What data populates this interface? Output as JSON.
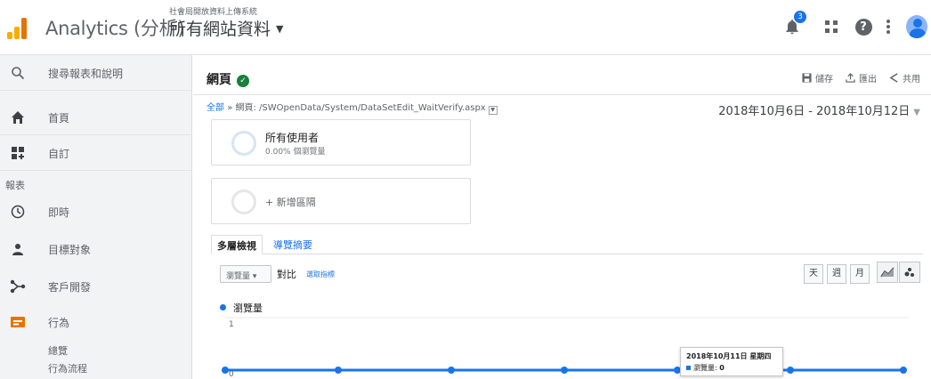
{
  "header": {
    "app_name": "Analytics (分析)",
    "account": "社會局開放資料上傳系統",
    "view": "所有網站資料",
    "notification_count": "3",
    "help_glyph": "?",
    "colors": {
      "logo_dark": "#e37400",
      "logo_light": "#f9ab00",
      "accent": "#1a73e8"
    }
  },
  "sidebar": {
    "search_label": "搜尋報表和說明",
    "home_label": "首頁",
    "custom_label": "自訂",
    "reports_section": "報表",
    "realtime_label": "即時",
    "audience_label": "目標對象",
    "acquisition_label": "客戶開發",
    "behavior_label": "行為",
    "sub_overview": "總覽",
    "sub_flow": "行為流程"
  },
  "main": {
    "title": "網頁",
    "actions": {
      "save": "儲存",
      "export": "匯出",
      "share": "共用"
    },
    "breadcrumb": {
      "all": "全部",
      "sep": "»",
      "page": "網頁: /SWOpenData/System/DataSetEdit_WaitVerify.aspx"
    },
    "date_range": "2018年10月6日 - 2018年10月12日",
    "segments": [
      {
        "name": "所有使用者",
        "sub": "0.00% 個瀏覽量"
      },
      {
        "add": "+ 新增區隔"
      }
    ],
    "tabs": [
      "多層檢視",
      "導覽摘要"
    ],
    "metric_select": "瀏覽量",
    "vs_label": "對比",
    "pick_metric": "選取指標",
    "periods": [
      "天",
      "週",
      "月"
    ]
  },
  "chart_data": {
    "type": "line",
    "series": [
      {
        "name": "瀏覽量",
        "values": [
          0,
          0,
          0,
          0,
          0,
          0,
          0
        ]
      }
    ],
    "y_ticks": [
      "1",
      "0"
    ],
    "ylim": [
      0,
      1
    ],
    "tooltip": {
      "date": "2018年10月11日 星期四",
      "label": "瀏覽量",
      "value": "0"
    },
    "color": "#1a73e8"
  }
}
